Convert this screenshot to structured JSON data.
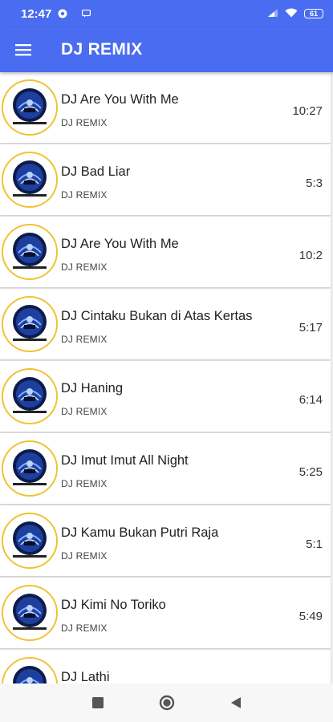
{
  "status_bar": {
    "time": "12:47",
    "battery": "61",
    "icons": [
      "notification-circle-icon",
      "message-icon",
      "signal-icon",
      "wifi-icon",
      "battery-icon"
    ]
  },
  "app_bar": {
    "title": "DJ REMIX",
    "menu_icon": "hamburger-menu-icon"
  },
  "colors": {
    "accent": "#4a6cf0",
    "thumb_border": "#f1c232"
  },
  "songs": [
    {
      "title": "DJ Are You With Me",
      "artist": "DJ REMIX",
      "duration": "10:27"
    },
    {
      "title": "DJ Bad Liar",
      "artist": "DJ REMIX",
      "duration": "5:3"
    },
    {
      "title": "DJ Are You With Me",
      "artist": "DJ REMIX",
      "duration": "10:2"
    },
    {
      "title": "DJ Cintaku Bukan di Atas Kertas",
      "artist": "DJ REMIX",
      "duration": "5:17"
    },
    {
      "title": "DJ Haning",
      "artist": "DJ REMIX",
      "duration": "6:14"
    },
    {
      "title": "DJ Imut Imut All Night",
      "artist": "DJ REMIX",
      "duration": "5:25"
    },
    {
      "title": "DJ Kamu Bukan Putri Raja",
      "artist": "DJ REMIX",
      "duration": "5:1"
    },
    {
      "title": "DJ Kimi No Toriko",
      "artist": "DJ REMIX",
      "duration": "5:49"
    },
    {
      "title": "DJ Lathi",
      "artist": "",
      "duration": ""
    }
  ],
  "nav_bar": {
    "buttons": [
      "recents-square-icon",
      "home-circle-icon",
      "back-triangle-icon"
    ]
  }
}
